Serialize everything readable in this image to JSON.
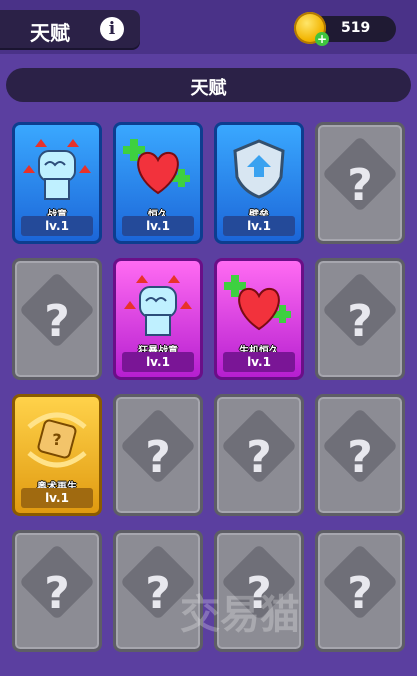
{
  "header": {
    "title": "天赋",
    "info_icon": "info-icon",
    "gold_count": "519"
  },
  "section": {
    "title": "天赋"
  },
  "cards": [
    {
      "state": "unlocked",
      "theme": "blue",
      "icon": "fist-up-icon",
      "name": "战意",
      "level": "lv.1"
    },
    {
      "state": "unlocked",
      "theme": "blue",
      "icon": "heart-plus-icon",
      "name": "恒久",
      "level": "lv.1"
    },
    {
      "state": "unlocked",
      "theme": "blue",
      "icon": "shield-icon",
      "name": "壁垒",
      "level": "lv.1"
    },
    {
      "state": "locked",
      "icon": "question-icon"
    },
    {
      "state": "locked",
      "icon": "question-icon"
    },
    {
      "state": "unlocked",
      "theme": "pink",
      "icon": "fist-up-icon",
      "name": "狂暴战意",
      "level": "lv.1"
    },
    {
      "state": "unlocked",
      "theme": "pink",
      "icon": "heart-plus-icon",
      "name": "生机恒久",
      "level": "lv.1"
    },
    {
      "state": "locked",
      "icon": "question-icon"
    },
    {
      "state": "unlocked",
      "theme": "gold",
      "icon": "dice-icon",
      "name": "奥术再生",
      "level": "lv.1"
    },
    {
      "state": "locked",
      "icon": "question-icon"
    },
    {
      "state": "locked",
      "icon": "question-icon"
    },
    {
      "state": "locked",
      "icon": "question-icon"
    },
    {
      "state": "locked",
      "icon": "question-icon"
    },
    {
      "state": "locked",
      "icon": "question-icon"
    },
    {
      "state": "locked",
      "icon": "question-icon"
    },
    {
      "state": "locked",
      "icon": "question-icon"
    }
  ],
  "locked_glyph": "?",
  "watermark": "交易猫",
  "colors": {
    "background": "#5b3fa0",
    "blue_card": "#2a86f0",
    "pink_card": "#d83be6",
    "gold_card": "#f0b62c",
    "locked_card": "#8c8c94"
  }
}
